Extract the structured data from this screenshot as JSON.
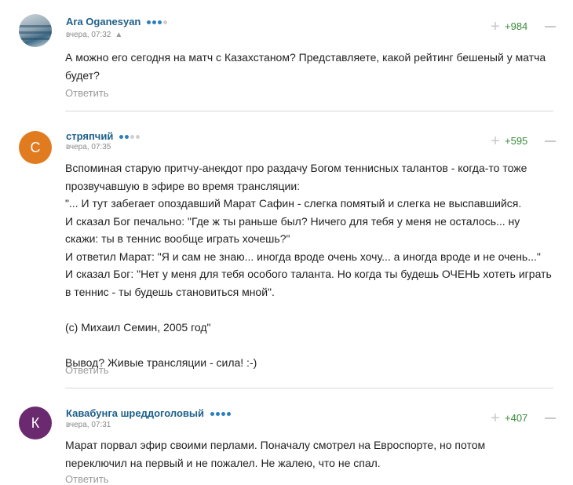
{
  "comments": [
    {
      "author": "Ara Oganesyan",
      "avatar_letter": "",
      "avatar_color": "#7f9fb3",
      "date": "вчера, 07:32",
      "device_icon": "android-icon",
      "rating_dots_filled": 3,
      "score": "+984",
      "lines": [
        "А можно его сегодня на матч с Казахстаном? Представляете, какой рейтинг бешеный у матча",
        "будет?"
      ],
      "reply": "Ответить"
    },
    {
      "author": "стряпчий",
      "avatar_letter": "С",
      "avatar_color": "#e07b1f",
      "date": "вчера, 07:35",
      "rating_dots_filled": 2,
      "score": "+595",
      "lines": [
        "Вспоминая старую притчу-анекдот про раздачу Богом теннисных талантов - когда-то тоже",
        "прозвучавшую в эфире во время трансляции:",
        "\"... И тут забегает опоздавший Марат Сафин - слегка помятый и слегка не выспавшийся.",
        "И сказал Бог печально: \"Где ж ты раньше был? Ничего для тебя у меня не осталось... ну",
        "скажи: ты в теннис вообще играть хочешь?\"",
        "И ответил Марат: \"Я и сам не знаю... иногда вроде очень хочу... а иногда вроде и не очень...\"",
        "И сказал Бог: \"Нет у меня для тебя особого таланта. Но когда ты будешь ОЧЕНЬ хотеть играть",
        "в теннис - ты будешь становиться мной\".",
        "",
        "(с) Михаил Семин, 2005 год\"",
        "",
        "Вывод? Живые трансляции - сила! :-)"
      ],
      "reply": "Ответить"
    },
    {
      "author": "Кавабунга шреддоголовый",
      "avatar_letter": "К",
      "avatar_color": "#6b2a6f",
      "date": "вчера, 07:31",
      "rating_dots_filled": 4,
      "score": "+407",
      "lines": [
        "Марат порвал эфир своими перлами. Поначалу смотрел на Евроспорте, но потом",
        "переключил на первый и не пожалел. Не жалею, что не спал."
      ],
      "reply": "Ответить"
    }
  ],
  "colors": {
    "author": "#1d5f8a",
    "score": "#3a8a3a",
    "dot_filled": "#2a7fc0",
    "dot_empty": "#cfcfcf"
  }
}
